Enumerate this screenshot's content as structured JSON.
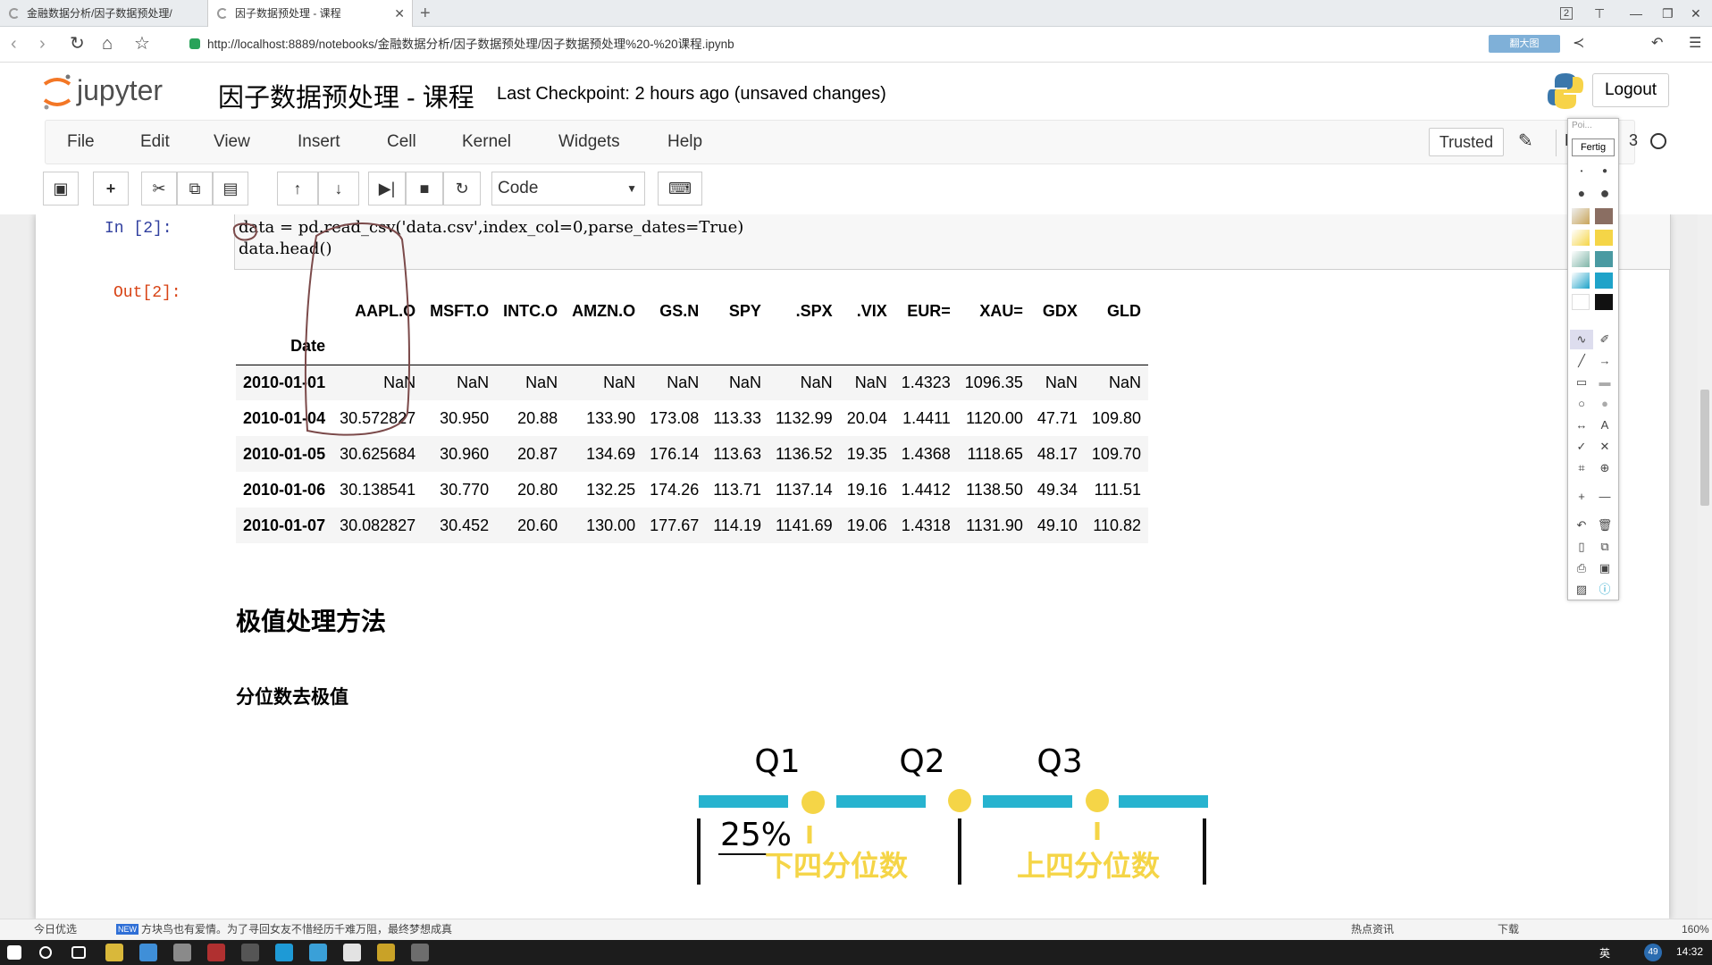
{
  "browser": {
    "tabs": [
      {
        "label": "金融数据分析/因子数据预处理/",
        "active": false
      },
      {
        "label": "因子数据预处理 - 课程",
        "active": true
      }
    ],
    "url": "http://localhost:8889/notebooks/金融数据分析/因子数据预处理/因子数据预处理%20-%20课程.ipynb",
    "ext_badge": "2",
    "right_badge": "翻大图"
  },
  "jupyter": {
    "logo_text": "jupyter",
    "title": "因子数据预处理 - 课程",
    "checkpoint": "Last Checkpoint: 2 hours ago (unsaved changes)",
    "logout": "Logout",
    "menu": [
      "File",
      "Edit",
      "View",
      "Insert",
      "Cell",
      "Kernel",
      "Widgets",
      "Help"
    ],
    "trusted": "Trusted",
    "kernel_name": "F",
    "kernel_num": "3",
    "cell_type": "Code"
  },
  "cell": {
    "in_prompt": "In  [2]:",
    "code_line1": "data = pd.read_csv('data.csv',index_col=0,parse_dates=True)",
    "code_line2": "data.head()",
    "out_prompt": "Out[2]:"
  },
  "dataframe": {
    "columns": [
      "AAPL.O",
      "MSFT.O",
      "INTC.O",
      "AMZN.O",
      "GS.N",
      "SPY",
      ".SPX",
      ".VIX",
      "EUR=",
      "XAU=",
      "GDX",
      "GLD"
    ],
    "index_name": "Date",
    "rows": [
      {
        "date": "2010-01-01",
        "values": [
          "NaN",
          "NaN",
          "NaN",
          "NaN",
          "NaN",
          "NaN",
          "NaN",
          "NaN",
          "1.4323",
          "1096.35",
          "NaN",
          "NaN"
        ]
      },
      {
        "date": "2010-01-04",
        "values": [
          "30.572827",
          "30.950",
          "20.88",
          "133.90",
          "173.08",
          "113.33",
          "1132.99",
          "20.04",
          "1.4411",
          "1120.00",
          "47.71",
          "109.80"
        ]
      },
      {
        "date": "2010-01-05",
        "values": [
          "30.625684",
          "30.960",
          "20.87",
          "134.69",
          "176.14",
          "113.63",
          "1136.52",
          "19.35",
          "1.4368",
          "1118.65",
          "48.17",
          "109.70"
        ]
      },
      {
        "date": "2010-01-06",
        "values": [
          "30.138541",
          "30.770",
          "20.80",
          "132.25",
          "174.26",
          "113.71",
          "1137.14",
          "19.16",
          "1.4412",
          "1138.50",
          "49.34",
          "111.51"
        ]
      },
      {
        "date": "2010-01-07",
        "values": [
          "30.082827",
          "30.452",
          "20.60",
          "130.00",
          "177.67",
          "114.19",
          "1141.69",
          "19.06",
          "1.4318",
          "1131.90",
          "49.10",
          "110.82"
        ]
      }
    ]
  },
  "markdown": {
    "h2": "极值处理方法",
    "h3": "分位数去极值"
  },
  "quartile_figure": {
    "q1": "Q1",
    "q2": "Q2",
    "q3": "Q3",
    "pct": "25%",
    "lower_quartile": "下四分位数",
    "upper_quartile": "上四分位数",
    "bar_color": "#27b3cf",
    "dot_color": "#f5d547"
  },
  "draw_panel": {
    "header": "Poi...",
    "fertig": "Fertig"
  },
  "status": {
    "left": "今日优选",
    "news_tag": "NEW",
    "news": "方块鸟也有爱情。为了寻回女友不惜经历千难万阻，最终梦想成真",
    "hot": "热点资讯",
    "download": "下载",
    "zoom": "160%"
  },
  "taskbar": {
    "lang": "英",
    "clock": "14:32",
    "badge": "49"
  }
}
